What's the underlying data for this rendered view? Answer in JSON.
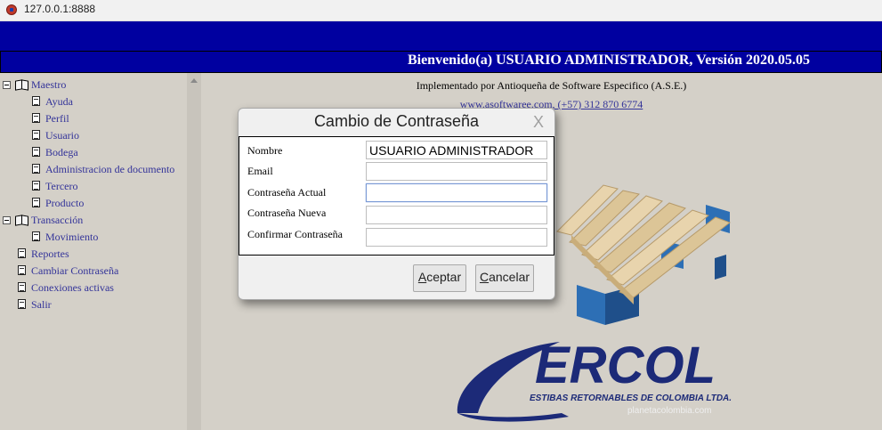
{
  "browser": {
    "url": "127.0.0.1:8888"
  },
  "header": {
    "welcome": "Bienvenido(a) USUARIO ADMINISTRADOR, Versión 2020.05.05"
  },
  "sidebar": {
    "items": [
      {
        "label": "Maestro",
        "type": "folder"
      },
      {
        "label": "Ayuda",
        "type": "page"
      },
      {
        "label": "Perfil",
        "type": "page"
      },
      {
        "label": "Usuario",
        "type": "page"
      },
      {
        "label": "Bodega",
        "type": "page"
      },
      {
        "label": "Administracion de documento",
        "type": "page"
      },
      {
        "label": "Tercero",
        "type": "page"
      },
      {
        "label": "Producto",
        "type": "page"
      },
      {
        "label": "Transacción",
        "type": "folder"
      },
      {
        "label": "Movimiento",
        "type": "page"
      },
      {
        "label": "Reportes",
        "type": "page"
      },
      {
        "label": "Cambiar Contraseña",
        "type": "page"
      },
      {
        "label": "Conexiones activas",
        "type": "page"
      },
      {
        "label": "Salir",
        "type": "page"
      }
    ]
  },
  "main": {
    "implemented_by": "Implementado por Antioqueña de Software Especifico (A.S.E.)",
    "contact": "www.asoftwaree.com, (+57) 312 870 6774",
    "logo": {
      "brand": "ERCOL",
      "tagline": "ESTIBAS RETORNABLES DE COLOMBIA LTDA.",
      "site": "planetacolombia.com"
    }
  },
  "dialog": {
    "title": "Cambio de Contraseña",
    "close": "X",
    "fields": [
      {
        "label": "Nombre",
        "value": "USUARIO ADMINISTRADOR"
      },
      {
        "label": "Email",
        "value": ""
      },
      {
        "label": "Contraseña Actual",
        "value": ""
      },
      {
        "label": "Contraseña Nueva",
        "value": ""
      },
      {
        "label": "Confirmar Contraseña",
        "value": ""
      }
    ],
    "accept": {
      "accel": "A",
      "rest": "ceptar"
    },
    "cancel": {
      "accel": "C",
      "rest": "ancelar"
    }
  },
  "colors": {
    "header_bg": "#0000a0",
    "link": "#333399",
    "background": "#d4d0c8",
    "logo_blue": "#1c2a78"
  },
  "icons": {
    "folder": "open-book-icon",
    "page": "document-icon",
    "expander": "collapse-minus-icon"
  }
}
